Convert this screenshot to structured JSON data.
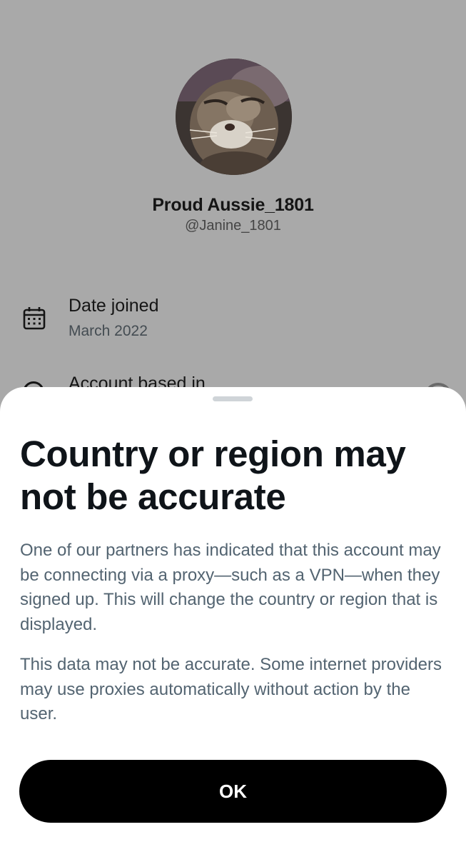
{
  "profile": {
    "display_name": "Proud Aussie_1801",
    "handle": "@Janine_1801",
    "avatar_icon": "cat-photo-avatar"
  },
  "about": {
    "items": [
      {
        "icon": "calendar-icon",
        "label": "Date joined",
        "value": "March 2022"
      },
      {
        "icon": "location-icon",
        "label": "Account based in",
        "value": ""
      }
    ]
  },
  "sheet": {
    "title": "Country or region may not be accurate",
    "paragraph_1": "One of our partners has indicated that this account may be connecting via a proxy—such as a VPN—when they signed up. This will change the country or region that is displayed.",
    "paragraph_2": "This data may not be accurate. Some internet providers may use proxies automatically without action by the user.",
    "ok_label": "OK"
  },
  "colors": {
    "backdrop": "#a9a9a9",
    "sheet_background": "#ffffff",
    "title_text": "#0f1419",
    "body_text": "#536471",
    "button_background": "#000000",
    "button_text": "#ffffff"
  }
}
